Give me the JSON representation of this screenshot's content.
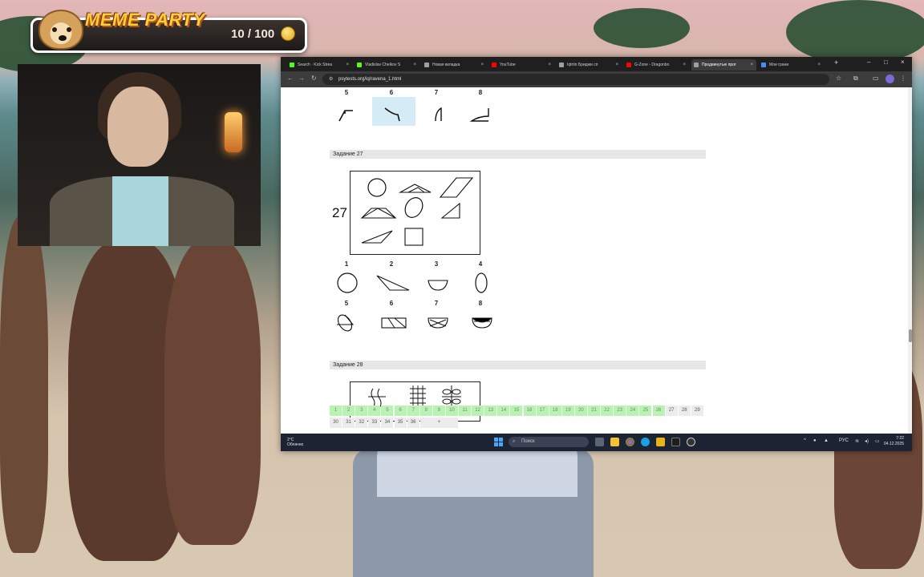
{
  "overlay": {
    "title": "MEME PARTY",
    "progress_text": "10 / 100",
    "progress_fraction": 0.1,
    "coin_icon": "coin-icon"
  },
  "browser": {
    "tabs": [
      {
        "label": "Search · Kick Strea",
        "icon_color": "#53fc18"
      },
      {
        "label": "Vladislav Chelkov S",
        "icon_color": "#53fc18"
      },
      {
        "label": "Новая вкладка",
        "icon_color": "#9aa0a6"
      },
      {
        "label": "YouTube",
        "icon_color": "#ff0000"
      },
      {
        "label": "Iqtrtin Бриджи сп",
        "icon_color": "#9aa0a6"
      },
      {
        "label": "G-Zone - Dragonbo",
        "icon_color": "#ff0000"
      },
      {
        "label": "Продвинутые прог",
        "icon_color": "#9aa0a6"
      },
      {
        "label": "Мои грани",
        "icon_color": "#4c8bf5"
      }
    ],
    "active_tab_index": 6,
    "url": "psytests.org/iq/ravena_1.html",
    "new_tab_label": "+",
    "window_controls": [
      "–",
      "□",
      "×"
    ]
  },
  "page": {
    "top_option_numbers": [
      "5",
      "6",
      "7",
      "8"
    ],
    "top_selected_option": "6",
    "task27": {
      "header": "Задание 27",
      "label": "27",
      "options_row1": [
        "1",
        "2",
        "3",
        "4"
      ],
      "options_row2": [
        "5",
        "6",
        "7",
        "8"
      ]
    },
    "task28": {
      "header": "Задание 28"
    },
    "nav_cells": [
      {
        "n": "1",
        "status": "done"
      },
      {
        "n": "2",
        "status": "done"
      },
      {
        "n": "3",
        "status": "done"
      },
      {
        "n": "4",
        "status": "done"
      },
      {
        "n": "5",
        "status": "done"
      },
      {
        "n": "6",
        "status": "done"
      },
      {
        "n": "7",
        "status": "done"
      },
      {
        "n": "8",
        "status": "done"
      },
      {
        "n": "9",
        "status": "done"
      },
      {
        "n": "10",
        "status": "done"
      },
      {
        "n": "11",
        "status": "done"
      },
      {
        "n": "12",
        "status": "done"
      },
      {
        "n": "13",
        "status": "done"
      },
      {
        "n": "14",
        "status": "done"
      },
      {
        "n": "15",
        "status": "done"
      },
      {
        "n": "16",
        "status": "done"
      },
      {
        "n": "17",
        "status": "done"
      },
      {
        "n": "18",
        "status": "done"
      },
      {
        "n": "19",
        "status": "done"
      },
      {
        "n": "20",
        "status": "done"
      },
      {
        "n": "21",
        "status": "done"
      },
      {
        "n": "22",
        "status": "done"
      },
      {
        "n": "23",
        "status": "done"
      },
      {
        "n": "24",
        "status": "done"
      },
      {
        "n": "25",
        "status": "done"
      },
      {
        "n": "26",
        "status": "done"
      },
      {
        "n": "27",
        "status": "todo"
      },
      {
        "n": "28",
        "status": "todo"
      },
      {
        "n": "29",
        "status": "todo"
      },
      {
        "n": "30",
        "status": "todo"
      },
      {
        "n": "31",
        "status": "todo"
      },
      {
        "n": "32",
        "status": "todo"
      },
      {
        "n": "33",
        "status": "todo"
      },
      {
        "n": "34",
        "status": "todo"
      },
      {
        "n": "35",
        "status": "todo"
      },
      {
        "n": "36",
        "status": "todo"
      },
      {
        "n": "+",
        "status": "todo"
      }
    ]
  },
  "taskbar": {
    "weather_temp": "2°C",
    "weather_desc": "Облачно",
    "search_placeholder": "Поиск",
    "lang": "РУС",
    "time": "7:22",
    "date": "04.12.2025"
  },
  "colors": {
    "answered": "#b9f2b3",
    "unanswered": "#ececec",
    "selected_option": "#d5ecf6",
    "accent": "#ffcf3a"
  }
}
